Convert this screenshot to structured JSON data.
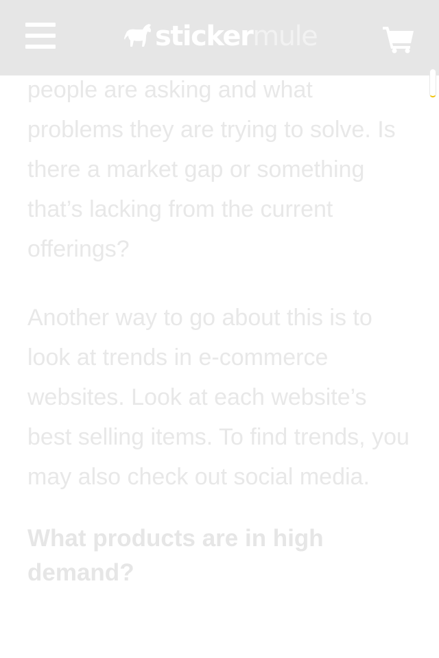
{
  "header": {
    "logo": {
      "part1": "sticker",
      "part2": "mule"
    },
    "menu_icon": "hamburger-menu-icon",
    "cart_icon": "shopping-cart-icon"
  },
  "article": {
    "paragraph1": "people are asking and what problems they are trying to solve. Is there a market gap or something that’s lacking from the current offerings?",
    "paragraph2": "Another way to go about this is to look at trends in e-commerce websites. Look at each website’s best selling items. To find trends, you may also check out social media.",
    "heading": "What products are in high demand?"
  },
  "colors": {
    "header_bg": "#e6e6e6",
    "text": "#e8e8e8",
    "accent": "#f0c000"
  }
}
